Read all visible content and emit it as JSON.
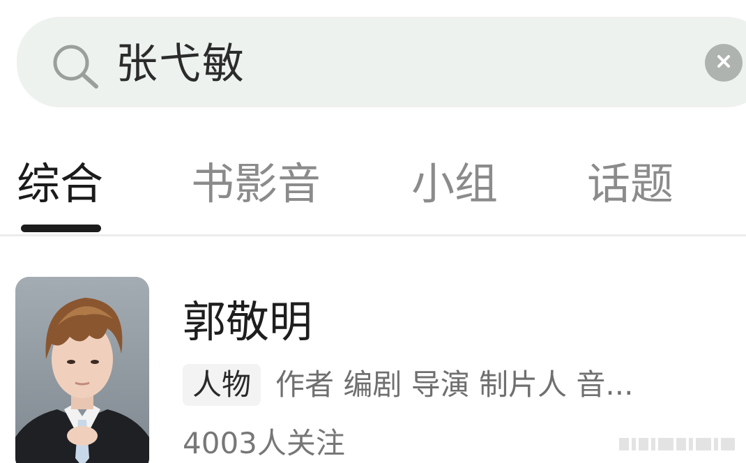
{
  "search": {
    "query": "张弋敏"
  },
  "tabs": [
    {
      "label": "综合",
      "active": true
    },
    {
      "label": "书影音",
      "active": false
    },
    {
      "label": "小组",
      "active": false
    },
    {
      "label": "话题",
      "active": false
    }
  ],
  "result": {
    "name": "郭敬明",
    "type": "人物",
    "roles": "作者 编剧 导演 制片人 音...",
    "followers": "4003人关注"
  },
  "icons": {
    "search": "search-icon",
    "clear": "close-icon"
  },
  "colors": {
    "search_bg": "#eef2ef",
    "active_tab": "#1b1b1b",
    "inactive_tab": "#8b8b8b",
    "indicator": "#1c1c1c"
  }
}
